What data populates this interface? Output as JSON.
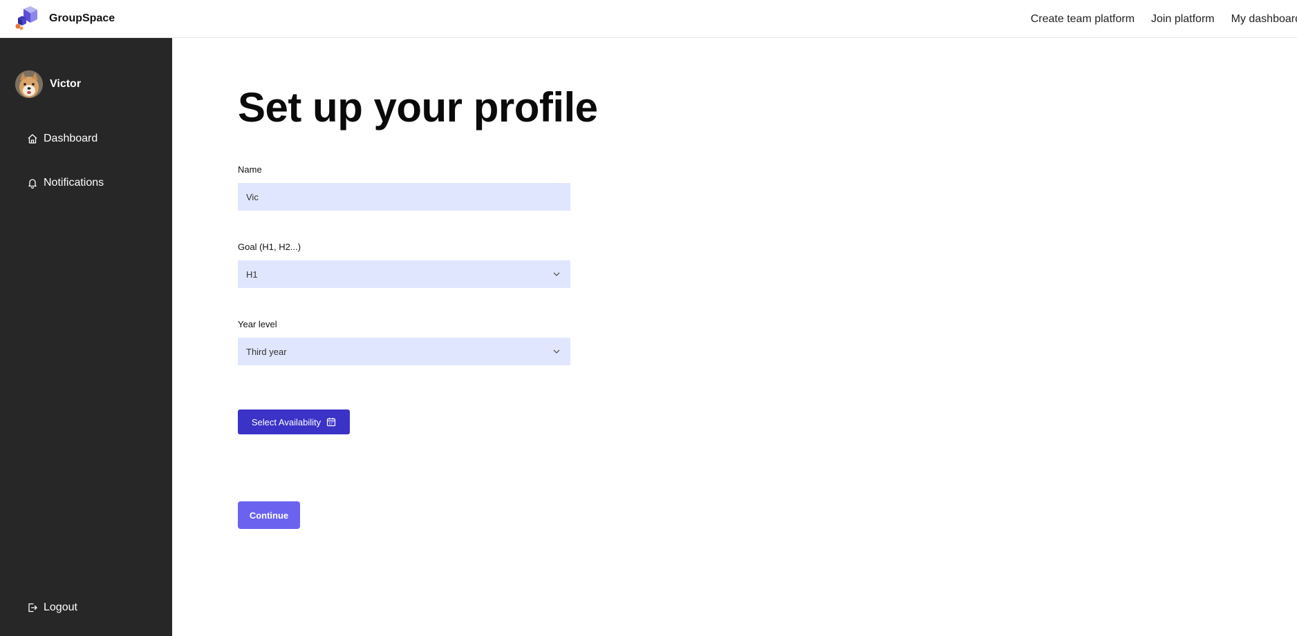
{
  "header": {
    "brand_name": "GroupSpace",
    "logo_icon": "puzzle-cube-logo-icon",
    "nav": [
      "Create team platform",
      "Join platform",
      "My dashboard"
    ]
  },
  "sidebar": {
    "user_name": "Victor",
    "items": [
      {
        "label": "Dashboard",
        "icon": "home-icon"
      },
      {
        "label": "Notifications",
        "icon": "bell-icon"
      }
    ],
    "logout_label": "Logout",
    "logout_icon": "logout-icon"
  },
  "main": {
    "title": "Set up your profile",
    "name_label": "Name",
    "name_value": "Vic",
    "goal_label": "Goal (H1, H2...)",
    "goal_value": "H1",
    "year_label": "Year level",
    "year_value": "Third year",
    "availability_button": "Select Availability",
    "continue_button": "Continue"
  },
  "colors": {
    "sidebar_bg": "#272727",
    "input_bg": "#e0e6fd",
    "primary_button": "#3b32c7",
    "continue_button": "#6b63f0"
  }
}
